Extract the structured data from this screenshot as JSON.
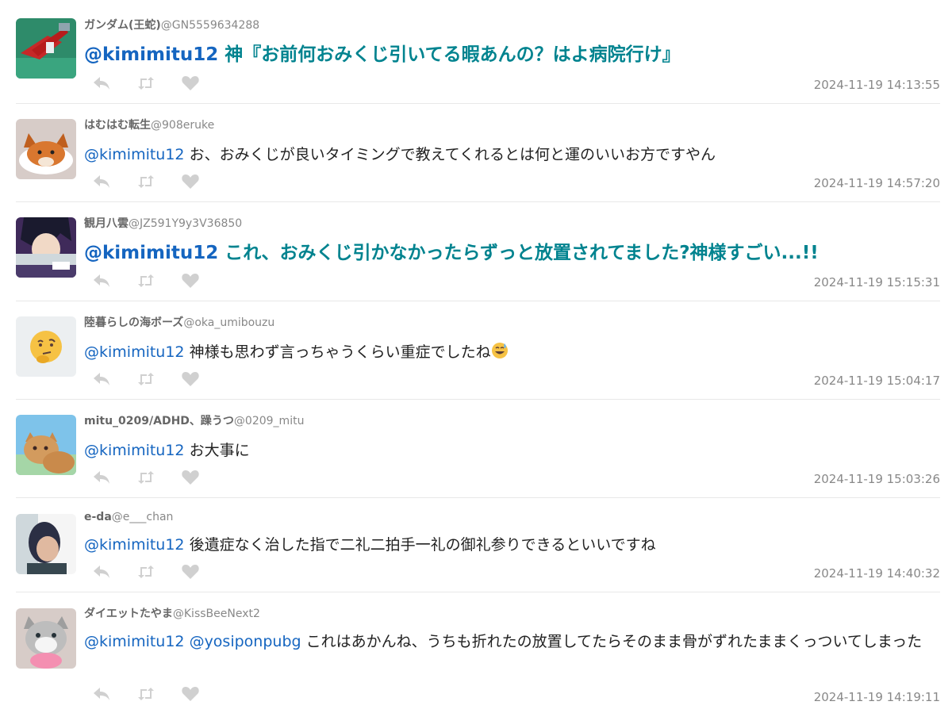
{
  "replies": [
    {
      "name": "ガンダム(王蛇)",
      "handle": "@GN5559634288",
      "mention": "@kimimitu12",
      "text": " 神『お前何おみくじ引いてる暇あんの？はよ病院行け』",
      "time": "2024-11-19 14:13:55",
      "big": true
    },
    {
      "name": "はむはむ転生",
      "handle": "@908eruke",
      "mention": "@kimimitu12",
      "text": " お、おみくじが良いタイミングで教えてくれるとは何と運のいいお方ですやん",
      "time": "2024-11-19 14:57:20",
      "big": false
    },
    {
      "name": "観月八雲",
      "handle": "@JZ591Y9y3V36850",
      "mention": "@kimimitu12",
      "text": " これ、おみくじ引かなかったらずっと放置されてました?神様すごい...!!",
      "time": "2024-11-19 15:15:31",
      "big": true
    },
    {
      "name": "陸暮らしの海ボーズ",
      "handle": "@oka_umibouzu",
      "mention": "@kimimitu12",
      "text": " 神様も思わず言っちゃうくらい重症でしたね",
      "time": "2024-11-19 15:04:17",
      "big": false
    },
    {
      "name": "mitu_0209/ADHD、躁うつ",
      "handle": "@0209_mitu",
      "mention": "@kimimitu12",
      "text": " お大事に",
      "time": "2024-11-19 15:03:26",
      "big": false
    },
    {
      "name": "e-da",
      "handle": "@e___chan",
      "mention": "@kimimitu12",
      "text": " 後遺症なく治した指で二礼二拍手一礼の御礼参りできるといいですね",
      "time": "2024-11-19 14:40:32",
      "big": false
    },
    {
      "name": "ダイエットたやま",
      "handle": "@KissBeeNext2",
      "mention": "@kimimitu12 @yosiponpubg",
      "text": " これはあかんね、うちも折れたの放置してたらそのまま骨がずれたままくっついてしまった",
      "time": "2024-11-19 14:19:11",
      "big": false
    }
  ],
  "icons": {
    "reply": "reply-icon",
    "retweet": "retweet-icon",
    "like": "heart-icon",
    "emoji": "sweat-smile-emoji"
  },
  "colors": {
    "mention": "#1565c0",
    "big_text": "#00838f",
    "muted": "#888888",
    "icon": "#d0d0d0"
  }
}
